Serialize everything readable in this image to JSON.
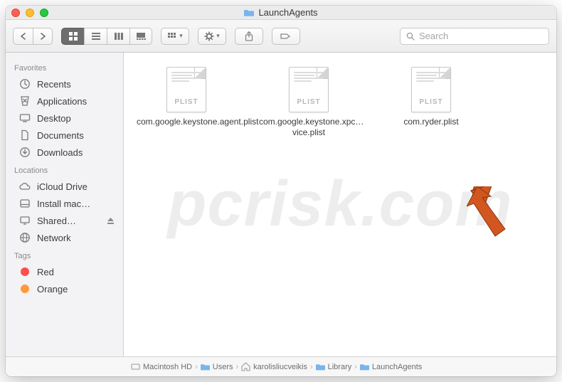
{
  "window": {
    "title": "LaunchAgents"
  },
  "search": {
    "placeholder": "Search"
  },
  "sidebar": {
    "sections": [
      {
        "header": "Favorites",
        "items": [
          {
            "icon": "clock-icon",
            "label": "Recents"
          },
          {
            "icon": "app-icon",
            "label": "Applications"
          },
          {
            "icon": "desktop-icon",
            "label": "Desktop"
          },
          {
            "icon": "doc-icon",
            "label": "Documents"
          },
          {
            "icon": "download-icon",
            "label": "Downloads"
          }
        ]
      },
      {
        "header": "Locations",
        "items": [
          {
            "icon": "cloud-icon",
            "label": "iCloud Drive"
          },
          {
            "icon": "disk-icon",
            "label": "Install mac…"
          },
          {
            "icon": "computer-icon",
            "label": "Shared…",
            "eject": true
          },
          {
            "icon": "network-icon",
            "label": "Network"
          }
        ]
      },
      {
        "header": "Tags",
        "items": [
          {
            "icon": "tag-red",
            "label": "Red"
          },
          {
            "icon": "tag-orange",
            "label": "Orange"
          }
        ]
      }
    ]
  },
  "files": [
    {
      "kind": "PLIST",
      "name": "com.google.keystone.agent.plist"
    },
    {
      "kind": "PLIST",
      "name": "com.google.keystone.xpc…vice.plist"
    },
    {
      "kind": "PLIST",
      "name": "com.ryder.plist"
    }
  ],
  "pathbar": [
    {
      "icon": "hd-icon",
      "label": "Macintosh HD"
    },
    {
      "icon": "folder-icon",
      "label": "Users"
    },
    {
      "icon": "home-icon",
      "label": "karolisliucveikis"
    },
    {
      "icon": "folder-icon",
      "label": "Library"
    },
    {
      "icon": "folder-icon",
      "label": "LaunchAgents"
    }
  ],
  "watermark": "pcrisk.com",
  "colors": {
    "arrow": "#d15620"
  }
}
